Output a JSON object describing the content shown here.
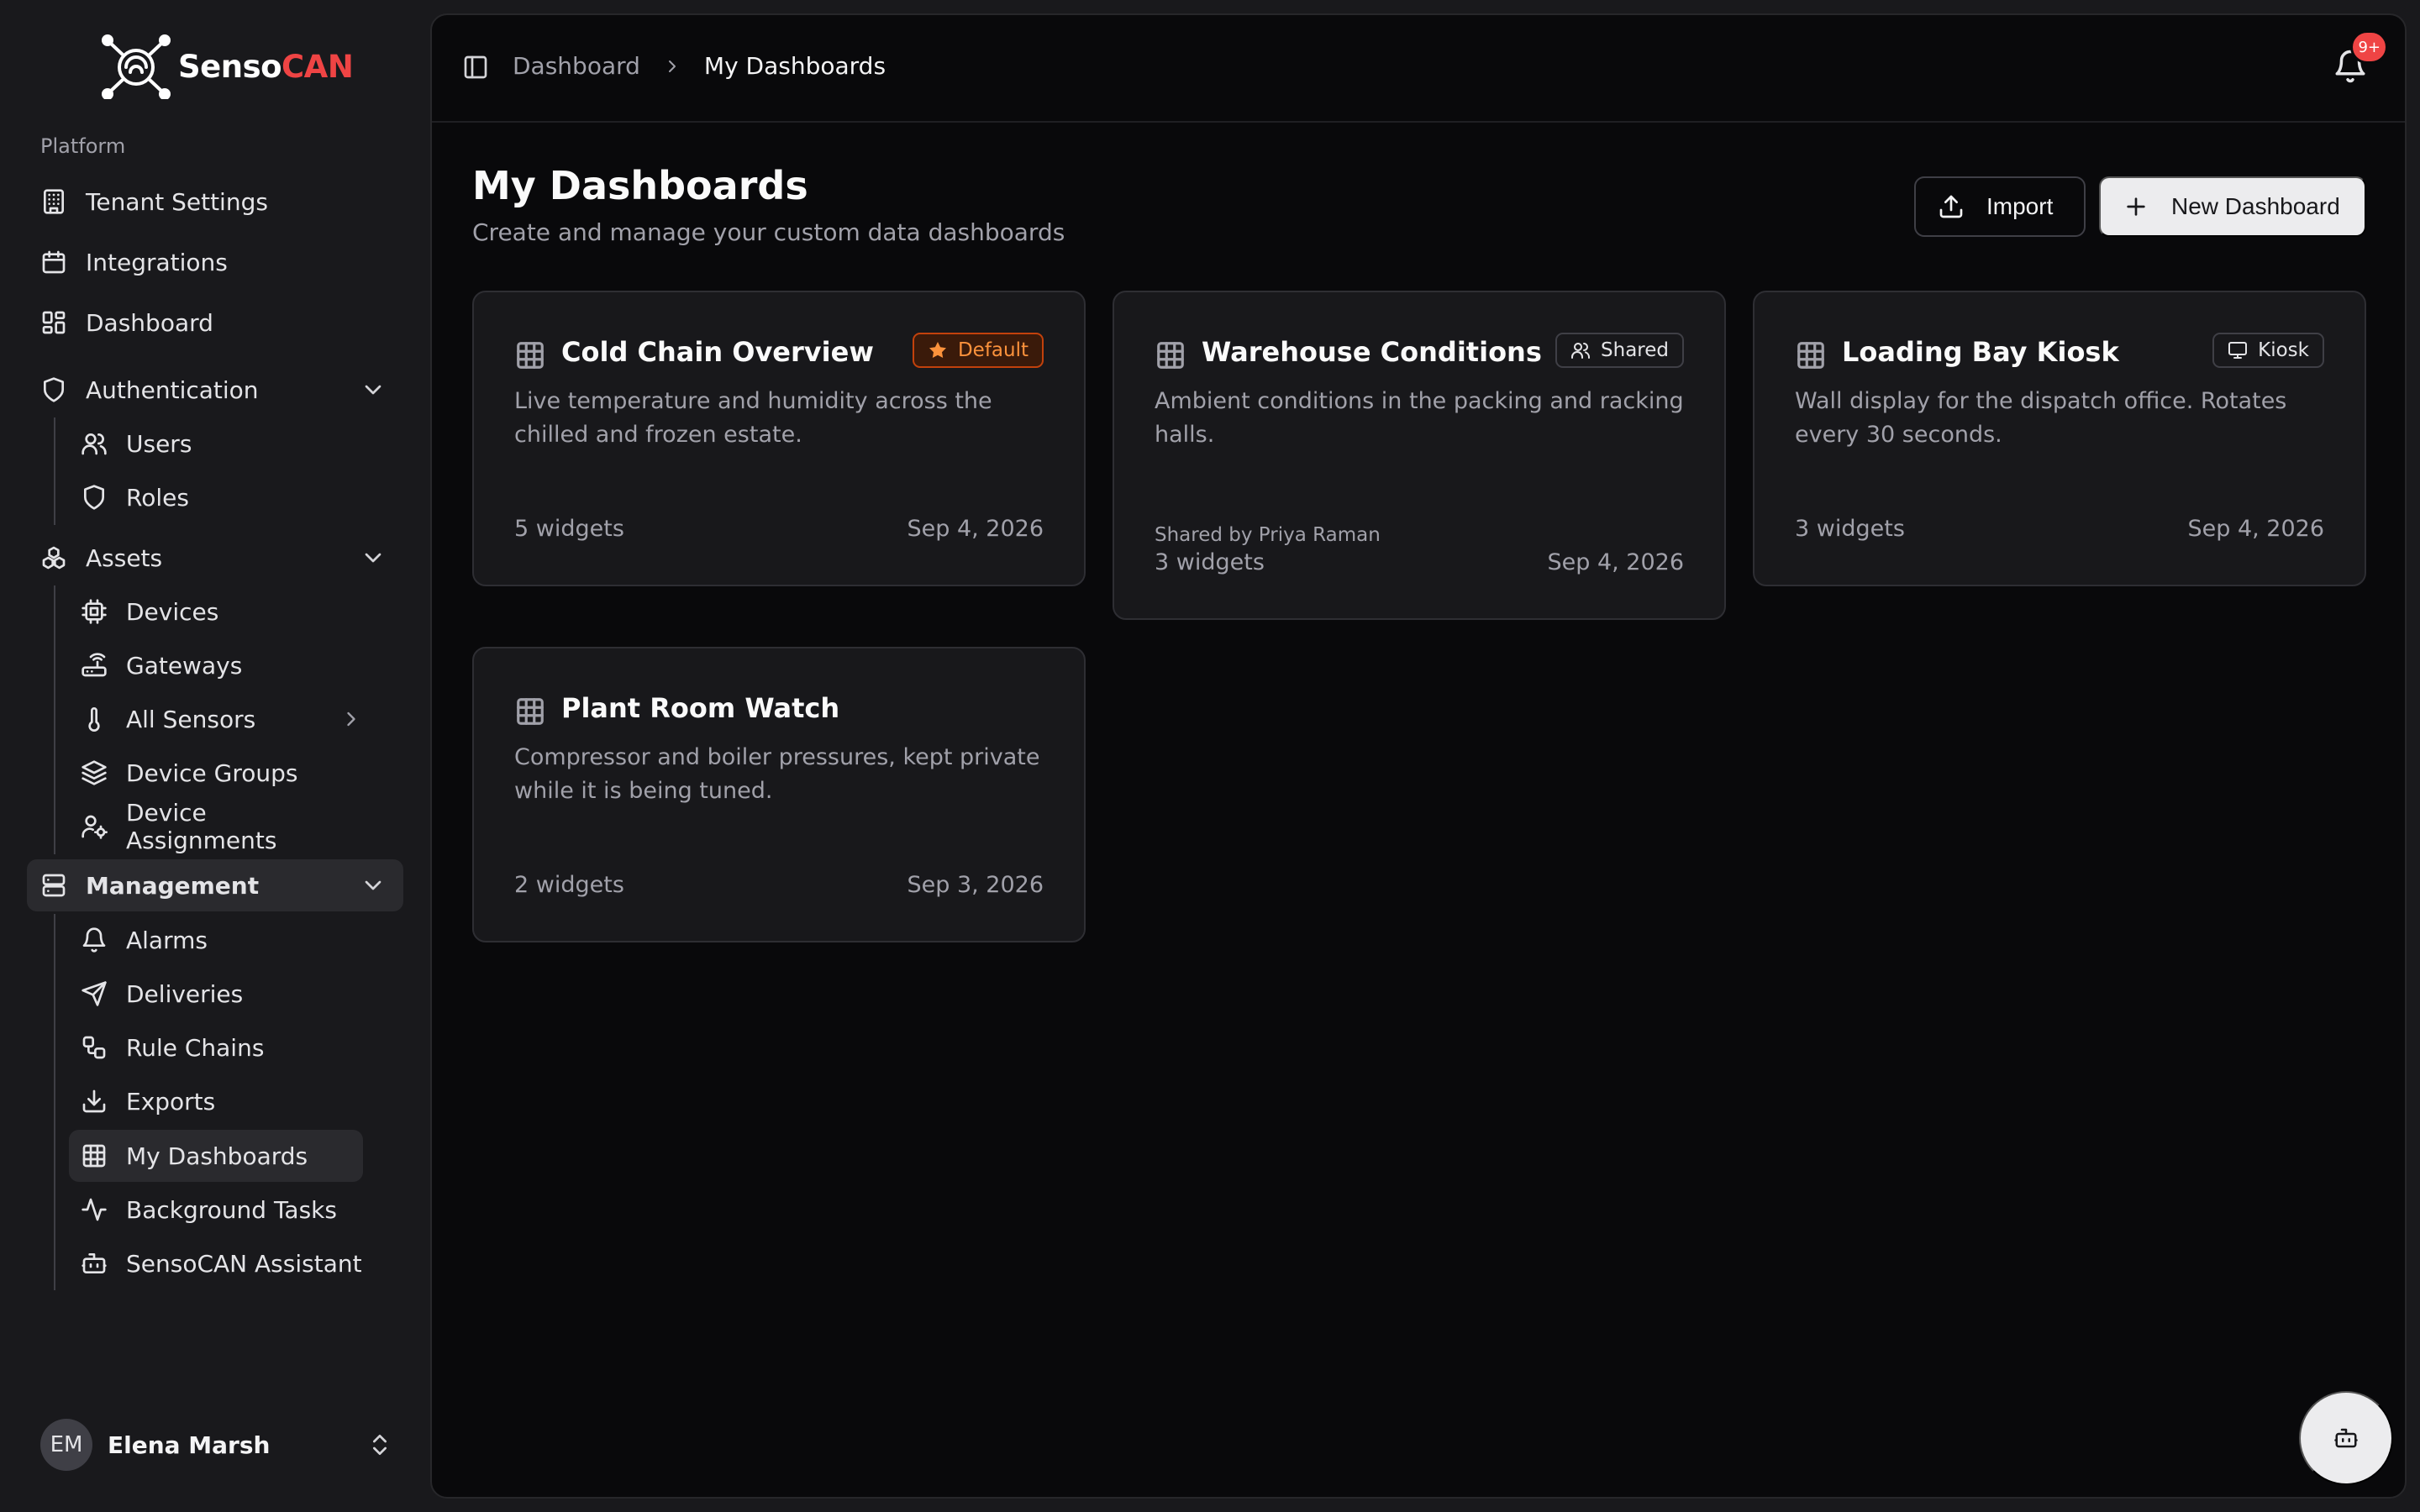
{
  "app": {
    "logo_text_part1": "Senso",
    "logo_text_part2": "CAN",
    "brand_color": "#ef4444"
  },
  "sidebar": {
    "section_label": "Platform",
    "items": {
      "tenant_settings": {
        "label": "Tenant Settings",
        "icon": "building-icon"
      },
      "integrations": {
        "label": "Integrations",
        "icon": "calendar-icon"
      },
      "dashboard": {
        "label": "Dashboard",
        "icon": "layout-dashboard-icon"
      },
      "authentication": {
        "label": "Authentication",
        "icon": "shield-icon",
        "expanded": true
      },
      "users": {
        "label": "Users",
        "icon": "users-icon"
      },
      "roles": {
        "label": "Roles",
        "icon": "shield-icon"
      },
      "assets": {
        "label": "Assets",
        "icon": "boxes-icon",
        "expanded": true
      },
      "devices": {
        "label": "Devices",
        "icon": "cpu-icon"
      },
      "gateways": {
        "label": "Gateways",
        "icon": "router-icon"
      },
      "all_sensors": {
        "label": "All Sensors",
        "icon": "thermometer-icon"
      },
      "device_groups": {
        "label": "Device Groups",
        "icon": "layers-icon"
      },
      "device_assignments": {
        "label": "Device Assignments",
        "icon": "user-cog-icon"
      },
      "management": {
        "label": "Management",
        "icon": "server-icon",
        "expanded": true
      },
      "alarms": {
        "label": "Alarms",
        "icon": "bell-icon"
      },
      "deliveries": {
        "label": "Deliveries",
        "icon": "send-icon"
      },
      "rule_chains": {
        "label": "Rule Chains",
        "icon": "workflow-icon"
      },
      "exports": {
        "label": "Exports",
        "icon": "download-icon"
      },
      "my_dashboards": {
        "label": "My Dashboards",
        "icon": "grid-icon",
        "active": true
      },
      "background_tasks": {
        "label": "Background Tasks",
        "icon": "activity-icon"
      },
      "assistant": {
        "label": "SensoCAN Assistant",
        "icon": "bot-icon"
      }
    },
    "user": {
      "initials": "EM",
      "name": "Elena Marsh"
    }
  },
  "header": {
    "breadcrumb_parent": "Dashboard",
    "breadcrumb_current": "My Dashboards",
    "notification_count": "9+"
  },
  "page": {
    "title": "My Dashboards",
    "subtitle": "Create and manage your custom data dashboards",
    "import_label": "Import",
    "new_label": "New Dashboard"
  },
  "dashboards": [
    {
      "title": "Cold Chain Overview",
      "badge": "Default",
      "description": "Live temperature and humidity across the chilled and frozen estate.",
      "widgets": "5 widgets",
      "date": "Sep 4, 2026"
    },
    {
      "title": "Warehouse Conditions",
      "badge": "Shared",
      "description": "Ambient conditions in the packing and racking halls.",
      "shared_by": "Shared by Priya Raman",
      "widgets": "3 widgets",
      "date": "Sep 4, 2026"
    },
    {
      "title": "Loading Bay Kiosk",
      "badge": "Kiosk",
      "description": "Wall display for the dispatch office. Rotates every 30 seconds.",
      "widgets": "3 widgets",
      "date": "Sep 4, 2026"
    },
    {
      "title": "Plant Room Watch",
      "description": "Compressor and boiler pressures, kept private while it is being tuned.",
      "widgets": "2 widgets",
      "date": "Sep 3, 2026"
    }
  ],
  "colors": {
    "default_badge": "#fb923c",
    "active_bg": "#2a2a2e",
    "primary_button_bg": "#ececee"
  }
}
